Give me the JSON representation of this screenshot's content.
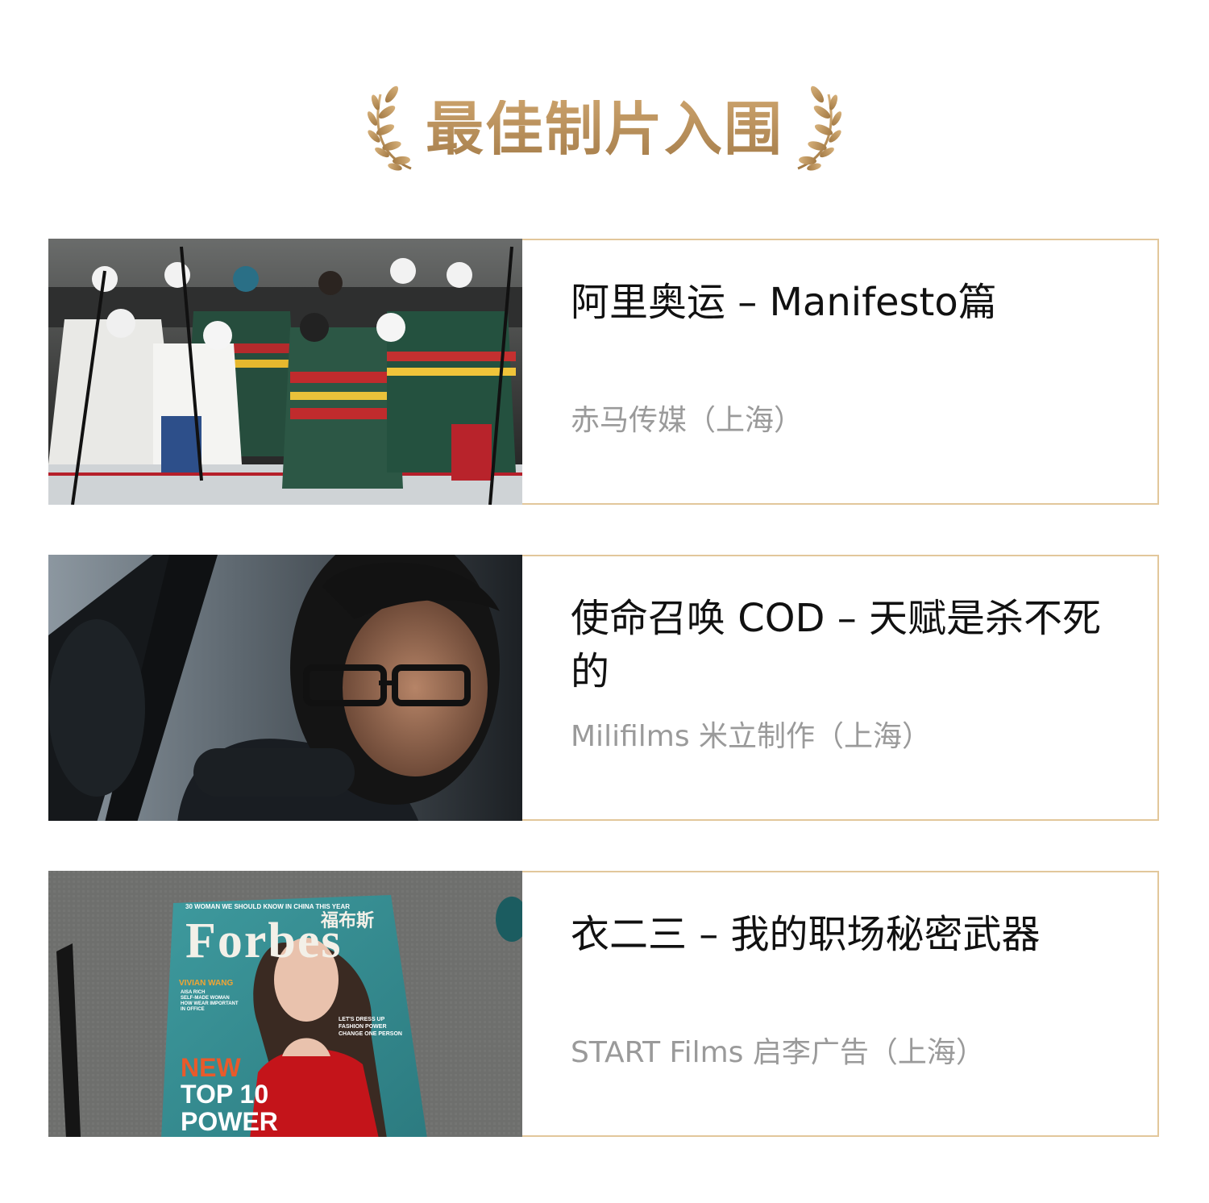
{
  "header": {
    "title": "最佳制片入围",
    "accent_color": "#b89160",
    "left_icon": "laurel-left-icon",
    "right_icon": "laurel-right-icon"
  },
  "nominees": [
    {
      "title": "阿里奥运 – Manifesto篇",
      "company": "赤马传媒（上海）",
      "image": "hockey-team-photo"
    },
    {
      "title": "使命召唤 COD – 天赋是杀不死的",
      "company": "Milifilms 米立制作（上海）",
      "image": "man-in-car-photo"
    },
    {
      "title": "衣二三 – 我的职场秘密武器",
      "company": "START Films 启李广告（上海）",
      "image": "magazine-cover-photo"
    }
  ],
  "magazine": {
    "masthead": "Forbes",
    "masthead_cn": "福布斯",
    "top_line": "30 WOMAN WE SHOULD KNOW IN CHINA THIS YEAR",
    "name": "VIVIAN WANG",
    "tag1": "AISA RICH",
    "tag2": "SELF-MADE WOMAN",
    "tag3": "HOW WEAR IMPORTANT",
    "tag4": "IN OFFICE",
    "side1": "LET'S DRESS UP",
    "side2": "FASHION POWER",
    "side3": "CHANGE ONE PERSON",
    "new": "NEW",
    "top10": "TOP 10",
    "power": "POWER"
  },
  "colors": {
    "border": "#e2c79b",
    "title": "#111111",
    "subtitle": "#9a9a9a"
  }
}
